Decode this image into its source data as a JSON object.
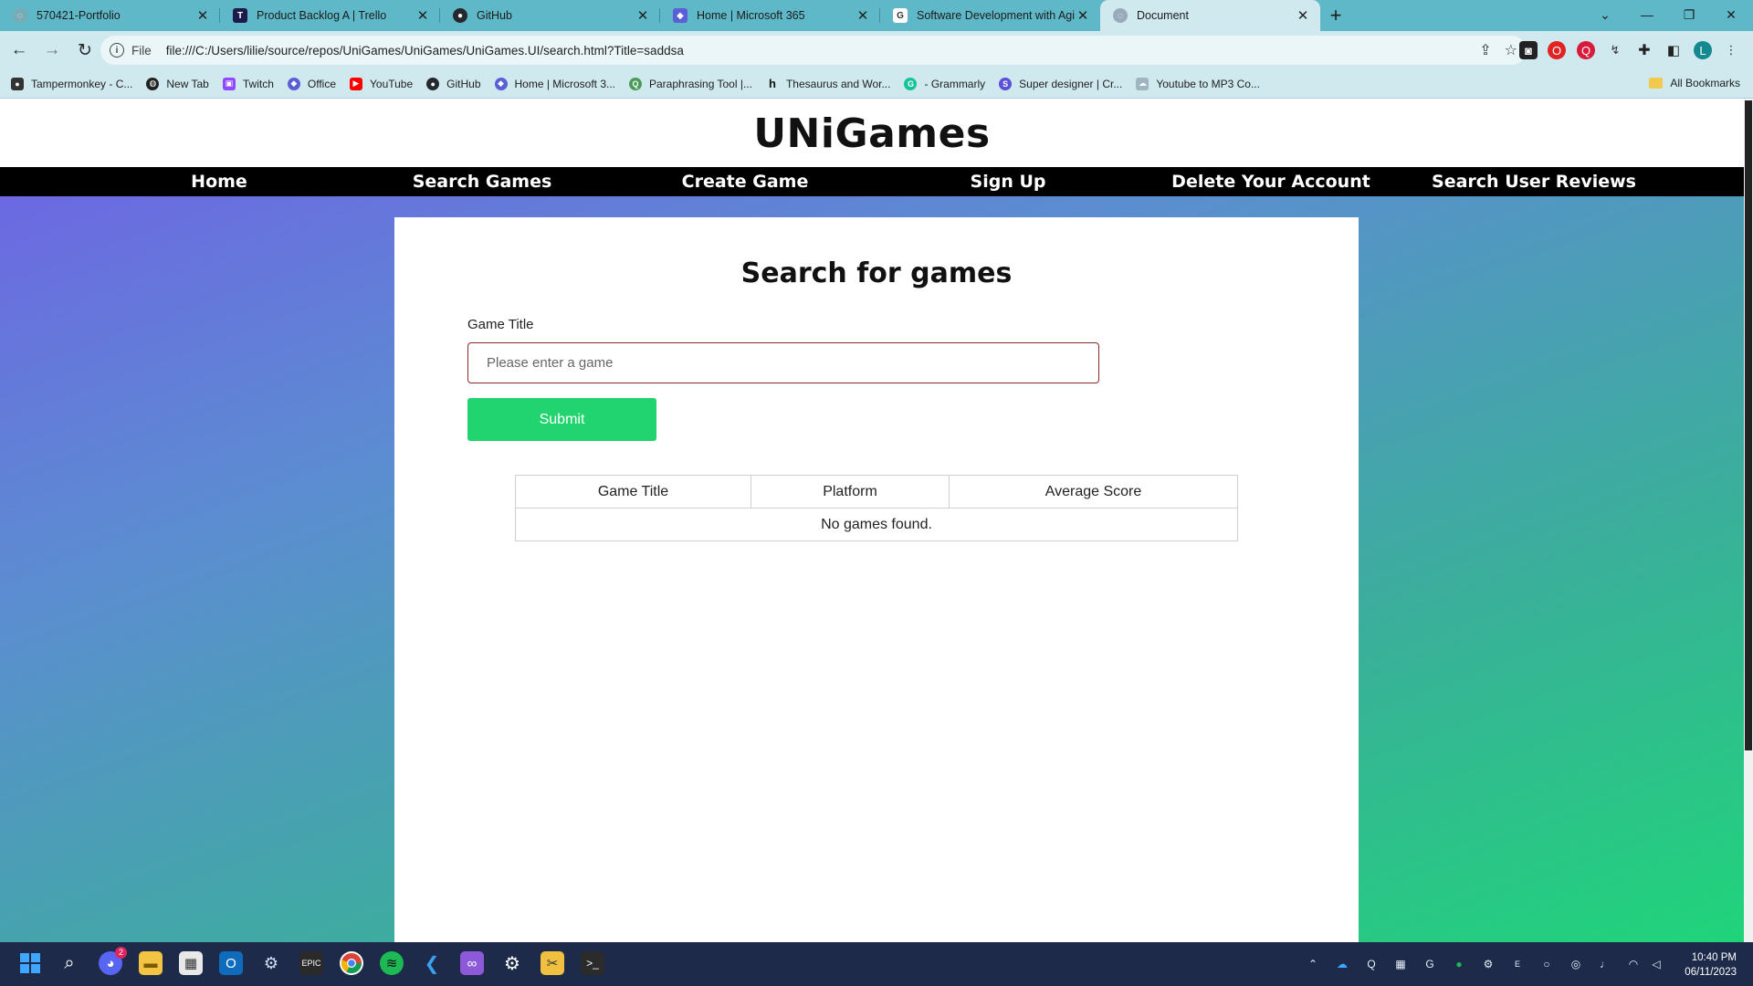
{
  "browser": {
    "tabs": [
      {
        "title": "570421-Portfolio",
        "icon": "globe-icon"
      },
      {
        "title": "Product Backlog A | Trello",
        "icon": "trello-icon"
      },
      {
        "title": "GitHub",
        "icon": "github-icon"
      },
      {
        "title": "Home | Microsoft 365",
        "icon": "m365-icon"
      },
      {
        "title": "Software Development with Agi",
        "icon": "google-icon"
      },
      {
        "title": "Document",
        "icon": "globe-icon",
        "active": true
      }
    ],
    "address": {
      "scheme": "File",
      "url": "file:///C:/Users/lilie/source/repos/UniGames/UniGames/UniGames.UI/search.html?Title=saddsa"
    },
    "profile_initial": "L",
    "bookmarks": [
      "Tampermonkey - C...",
      "New Tab",
      "Twitch",
      "Office",
      "YouTube",
      "GitHub",
      "Home | Microsoft 3...",
      "Paraphrasing Tool |...",
      "Thesaurus and Wor...",
      "- Grammarly",
      "Super designer | Cr...",
      "Youtube to MP3 Co..."
    ],
    "all_bookmarks": "All Bookmarks"
  },
  "site": {
    "logo": "UNiGames",
    "nav": [
      "Home",
      "Search Games",
      "Create Game",
      "Sign Up",
      "Delete Your Account",
      "Search User Reviews"
    ],
    "search": {
      "heading": "Search for games",
      "label": "Game Title",
      "placeholder": "Please enter a game",
      "submit": "Submit"
    },
    "results": {
      "columns": [
        "Game Title",
        "Platform",
        "Average Score"
      ],
      "empty_message": "No games found."
    }
  },
  "colors": {
    "nav_bg": "#000000",
    "submit_bg": "#22d46f",
    "gradient_start": "#7060e6",
    "gradient_end": "#20d47a"
  },
  "taskbar": {
    "time": "10:40 PM",
    "date": "06/11/2023",
    "discord_badge": "2"
  }
}
